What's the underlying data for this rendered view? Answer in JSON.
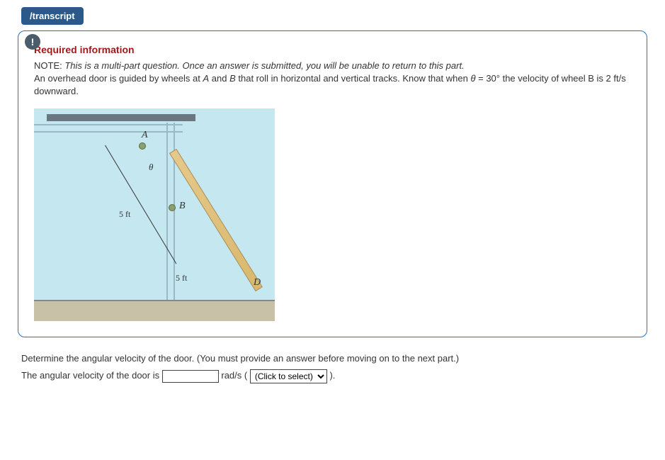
{
  "tab": {
    "label": "/transcript"
  },
  "badge": {
    "glyph": "!"
  },
  "required": {
    "heading": "Required information",
    "note_prefix": "NOTE:",
    "note_italic": "This is a multi-part question. Once an answer is submitted, you will be unable to return to this part.",
    "body_1": "An overhead door is guided by wheels at ",
    "body_A": "A",
    "body_2": " and ",
    "body_B": "B",
    "body_3": " that roll in horizontal and vertical tracks. Know that when ",
    "body_theta": "θ",
    "body_4": " = 30° the velocity of wheel B is 2 ft/s downward."
  },
  "figure": {
    "label_A": "A",
    "label_B": "B",
    "label_D": "D",
    "label_theta": "θ",
    "dim_upper": "5 ft",
    "dim_lower": "5 ft"
  },
  "question": {
    "prompt": "Determine the angular velocity of the door. (You must provide an answer before moving on to the next part.)",
    "answer_label_1": "The angular velocity of the door is ",
    "unit": " rad/s ( ",
    "select_placeholder": "(Click to select)",
    "closing": " )."
  }
}
